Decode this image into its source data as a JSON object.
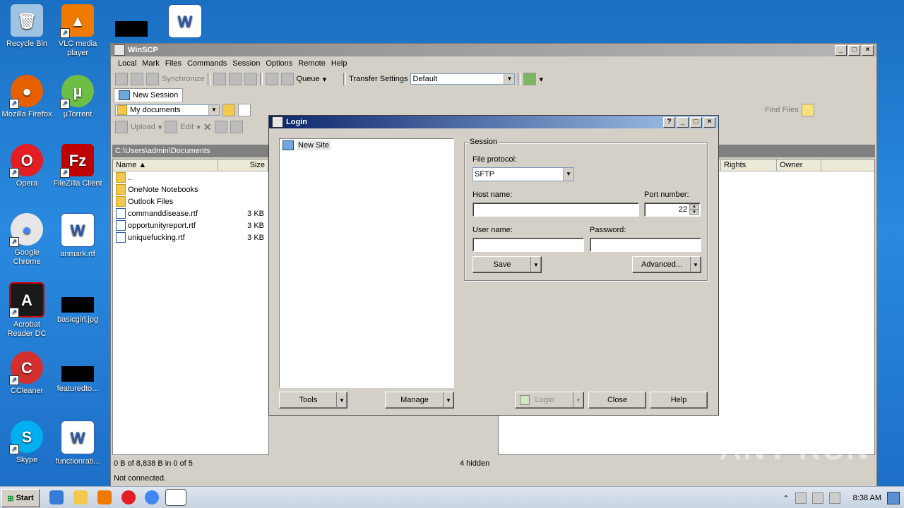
{
  "desktop": {
    "icons": [
      {
        "label": "Recycle Bin",
        "icon": "recycle-bin-icon"
      },
      {
        "label": "VLC media player",
        "icon": "vlc-icon"
      },
      {
        "label": "Mozilla Firefox",
        "icon": "firefox-icon"
      },
      {
        "label": "µTorrent",
        "icon": "utorrent-icon"
      },
      {
        "label": "Opera",
        "icon": "opera-icon"
      },
      {
        "label": "FileZilla Client",
        "icon": "filezilla-icon"
      },
      {
        "label": "Google Chrome",
        "icon": "chrome-icon"
      },
      {
        "label": "anmark.rtf",
        "icon": "word-doc-icon"
      },
      {
        "label": "Acrobat Reader DC",
        "icon": "acrobat-icon"
      },
      {
        "label": "basicgirl.jpg",
        "icon": "image-file-icon"
      },
      {
        "label": "CCleaner",
        "icon": "ccleaner-icon"
      },
      {
        "label": "featuredto...",
        "icon": "file-icon"
      },
      {
        "label": "Skype",
        "icon": "skype-icon"
      },
      {
        "label": "functionrati...",
        "icon": "word-doc-icon"
      }
    ]
  },
  "winscp": {
    "title": "WinSCP",
    "menu": [
      "Local",
      "Mark",
      "Files",
      "Commands",
      "Session",
      "Options",
      "Remote",
      "Help"
    ],
    "toolbar": {
      "synchronize": "Synchronize",
      "queue": "Queue",
      "transfer_settings": "Transfer Settings",
      "transfer_value": "Default"
    },
    "tab": "New Session",
    "location": "My documents",
    "local_toolbar": {
      "upload": "Upload",
      "edit": "Edit"
    },
    "find_files": "Find Files",
    "path": "C:\\Users\\admin\\Documents",
    "columns": {
      "name": "Name",
      "size": "Size",
      "rights": "Rights",
      "owner": "Owner"
    },
    "files": [
      {
        "name": "..",
        "size": "",
        "type": "up"
      },
      {
        "name": "OneNote Notebooks",
        "size": "",
        "type": "folder"
      },
      {
        "name": "Outlook Files",
        "size": "",
        "type": "folder"
      },
      {
        "name": "commanddisease.rtf",
        "size": "3 KB",
        "type": "doc"
      },
      {
        "name": "opportunityreport.rtf",
        "size": "3 KB",
        "type": "doc"
      },
      {
        "name": "uniquefucking.rtf",
        "size": "3 KB",
        "type": "doc"
      }
    ],
    "status": {
      "selection": "0 B of 8,838 B in 0 of 5",
      "hidden": "4 hidden",
      "connection": "Not connected."
    }
  },
  "login": {
    "title": "Login",
    "site": "New Site",
    "session_label": "Session",
    "file_protocol_label": "File protocol:",
    "file_protocol_value": "SFTP",
    "host_label": "Host name:",
    "host_value": "",
    "port_label": "Port number:",
    "port_value": "22",
    "user_label": "User name:",
    "user_value": "",
    "password_label": "Password:",
    "password_value": "",
    "save": "Save",
    "advanced": "Advanced...",
    "tools": "Tools",
    "manage": "Manage",
    "login": "Login",
    "close": "Close",
    "help": "Help"
  },
  "taskbar": {
    "start": "Start",
    "time": "8:38 AM"
  },
  "watermark": "ANY RUN"
}
